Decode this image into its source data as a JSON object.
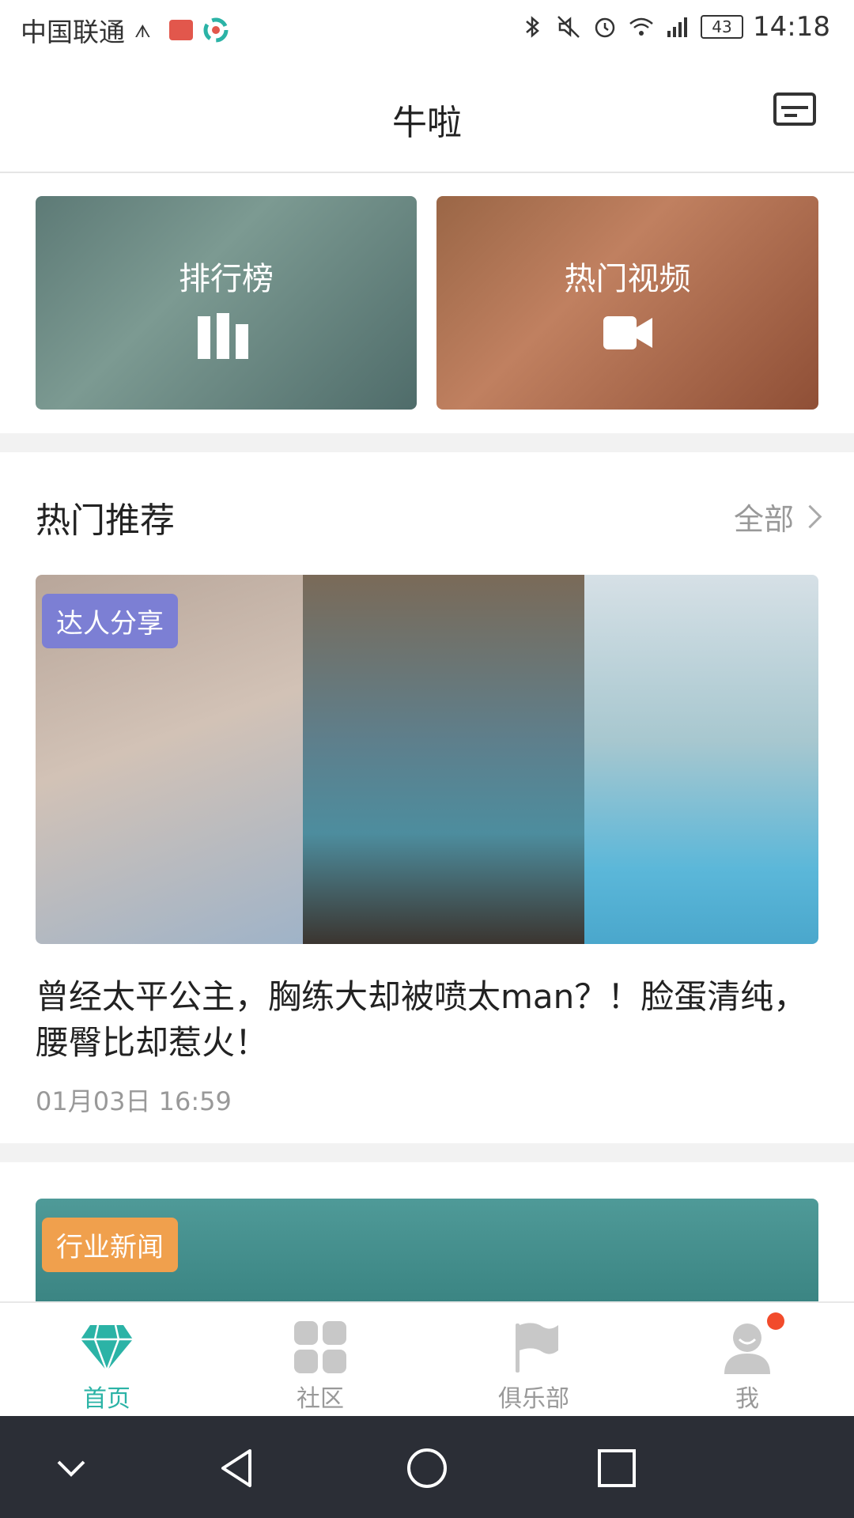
{
  "status_bar": {
    "carrier": "中国联通",
    "battery": "43",
    "time": "14:18"
  },
  "header": {
    "title": "牛啦"
  },
  "tiles": [
    {
      "label": "排行榜",
      "icon": "bar-chart-icon"
    },
    {
      "label": "热门视频",
      "icon": "video-camera-icon"
    }
  ],
  "section": {
    "title": "热门推荐",
    "all_label": "全部"
  },
  "articles": [
    {
      "tag": "达人分享",
      "title": "曾经太平公主，胸练大却被喷太man？！脸蛋清纯，腰臀比却惹火！",
      "date": "01月03日 16:59"
    },
    {
      "tag": "行业新闻"
    }
  ],
  "tabbar": {
    "items": [
      {
        "label": "首页",
        "icon": "diamond-icon",
        "active": true
      },
      {
        "label": "社区",
        "icon": "grid-icon",
        "active": false
      },
      {
        "label": "俱乐部",
        "icon": "flag-icon",
        "active": false
      },
      {
        "label": "我",
        "icon": "user-icon",
        "active": false
      }
    ],
    "accent": "#2bb3a6",
    "badge_color": "#f24b2b"
  },
  "navbar": {
    "icons": [
      "chevron-down-icon",
      "back-triangle-icon",
      "home-circle-icon",
      "recents-square-icon"
    ]
  }
}
